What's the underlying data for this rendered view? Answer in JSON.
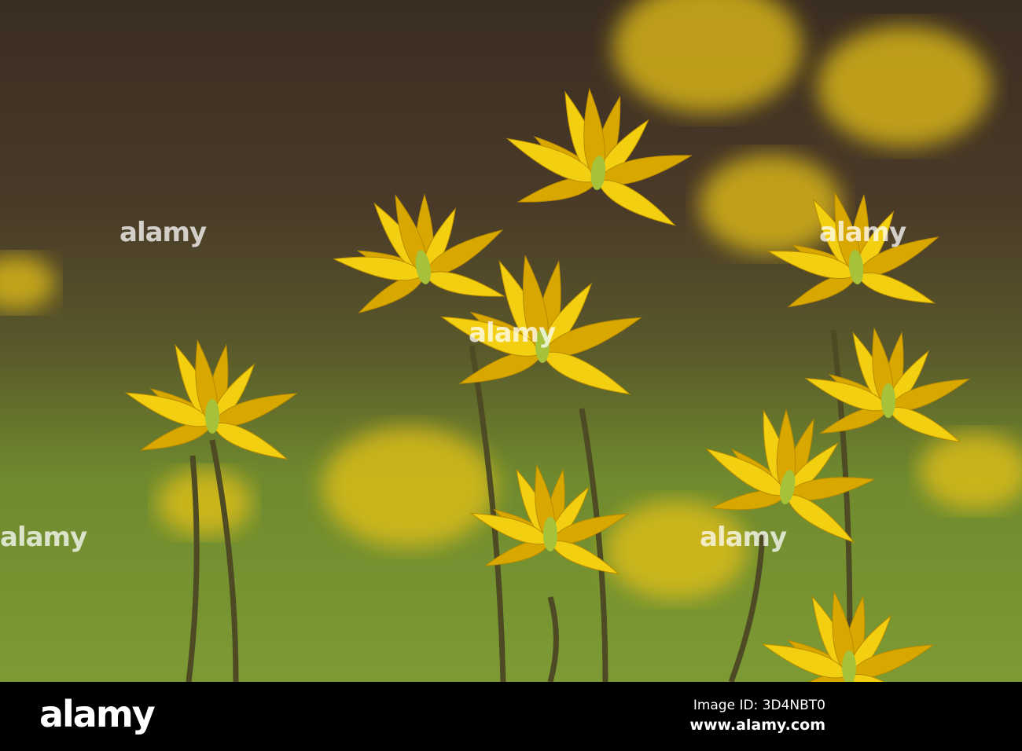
{
  "photo": {
    "subject": "yellow wild tulips",
    "watermark_text": "alamy",
    "colors": {
      "petal": "#f2cf10",
      "petal_shade": "#d9a800",
      "stem": "#4d4a24",
      "background_top": "#3a2e22",
      "background_bottom": "#7c9a34"
    }
  },
  "footer": {
    "logo": "alamy",
    "image_id": "Image ID: 3D4NBT0",
    "website": "www.alamy.com"
  }
}
